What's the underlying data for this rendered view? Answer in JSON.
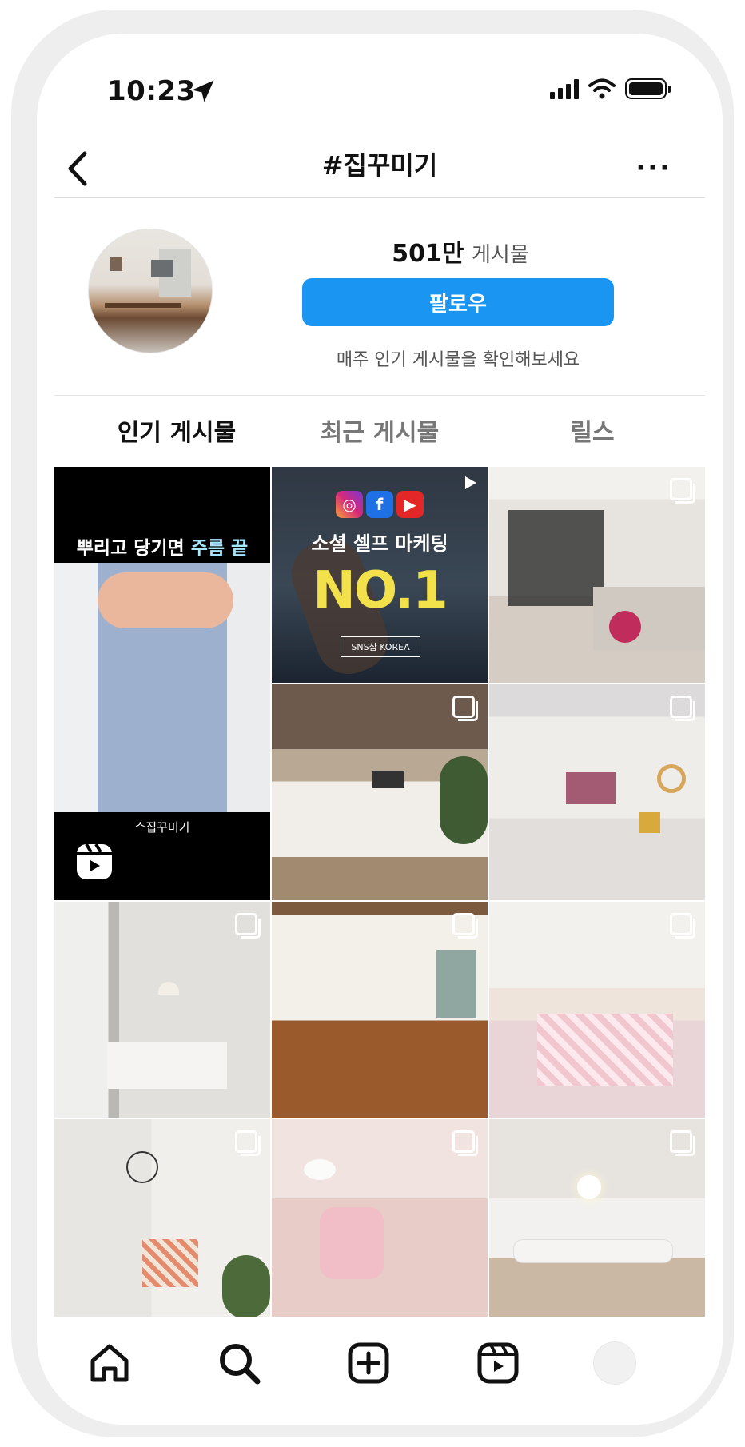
{
  "status_bar": {
    "time": "10:23"
  },
  "header": {
    "title": "#집꾸미기",
    "more": "···"
  },
  "profile": {
    "post_count": "501만",
    "post_label": "게시물",
    "follow_label": "팔로우",
    "subtext": "매주 인기 게시물을 확인해보세요"
  },
  "tabs": [
    {
      "label": "인기 게시물",
      "active": true
    },
    {
      "label": "최근 게시물",
      "active": false
    },
    {
      "label": "릴스",
      "active": false
    }
  ],
  "grid": {
    "reel": {
      "caption_plain": "뿌리고 당기면 ",
      "caption_highlight": "주름 끝",
      "tag": "ᄉ집꾸미기"
    },
    "ad": {
      "headline": "소셜 셀프 마케팅",
      "big": "NO.1",
      "badge": "SNS샵 KOREA"
    }
  },
  "colors": {
    "accent": "#1a96f2",
    "text_primary": "#111111",
    "text_secondary": "#555555",
    "divider": "#dbdbdb"
  },
  "icons": {
    "nav": [
      "home-icon",
      "search-icon",
      "create-icon",
      "reels-icon",
      "profile-avatar"
    ],
    "header": [
      "back-icon",
      "more-icon"
    ],
    "status": [
      "location-arrow-icon",
      "signal-icon",
      "wifi-icon",
      "battery-icon"
    ]
  }
}
